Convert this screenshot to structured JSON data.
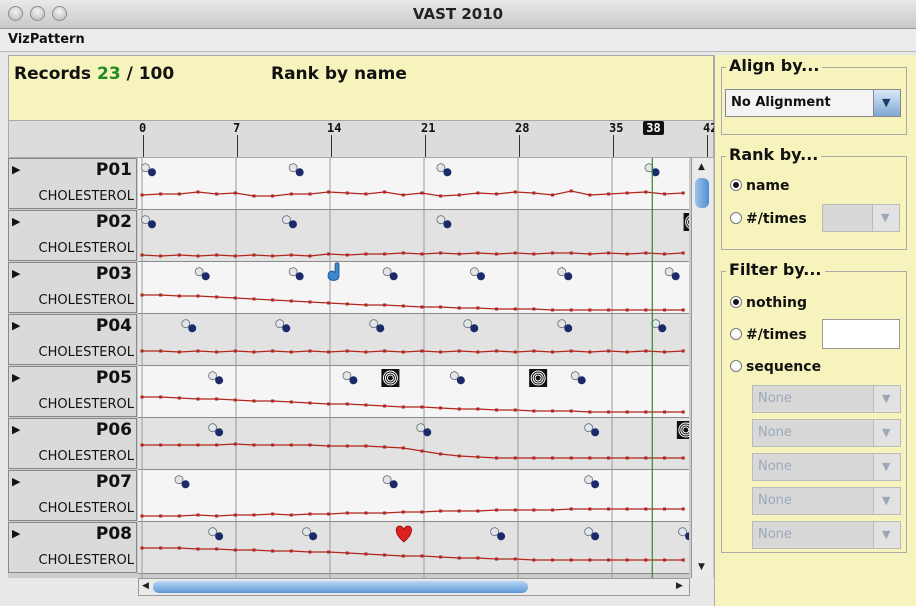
{
  "window": {
    "title": "VAST 2010"
  },
  "menu": {
    "item": "VizPattern"
  },
  "header": {
    "records_label": "Records",
    "records_count": "23",
    "records_sep": "/",
    "records_total": "100",
    "rank_label": "Rank by name"
  },
  "timeline": {
    "ticks": [
      "0",
      "7",
      "14",
      "21",
      "28",
      "35",
      "42"
    ],
    "cursor_value": "38",
    "max_day": 42
  },
  "records": [
    {
      "id": "P01",
      "variable": "CHOLESTEROL",
      "events": [
        {
          "type": "pill",
          "day": 0.5
        },
        {
          "type": "pill",
          "day": 11.5
        },
        {
          "type": "pill",
          "day": 22.5
        },
        {
          "type": "pill",
          "day": 38
        }
      ],
      "series": [
        37,
        36,
        36,
        34,
        36,
        35,
        38,
        38,
        36,
        36,
        34,
        35,
        36,
        34,
        37,
        35,
        38,
        37,
        35,
        36,
        34,
        35,
        37,
        33,
        37,
        36,
        35,
        34,
        36,
        35
      ]
    },
    {
      "id": "P02",
      "variable": "CHOLESTEROL",
      "events": [
        {
          "type": "pill",
          "day": 0.5
        },
        {
          "type": "pill",
          "day": 11
        },
        {
          "type": "pill",
          "day": 22.5
        },
        {
          "type": "spiral",
          "day": 41
        }
      ],
      "series": [
        45,
        46,
        45,
        46,
        45,
        46,
        45,
        46,
        45,
        46,
        44,
        45,
        44,
        44,
        43,
        44,
        43,
        44,
        43,
        44,
        43,
        44,
        43,
        43,
        44,
        43,
        44,
        43,
        44,
        43
      ]
    },
    {
      "id": "P03",
      "variable": "CHOLESTEROL",
      "events": [
        {
          "type": "pill",
          "day": 4.5
        },
        {
          "type": "pill",
          "day": 11.5
        },
        {
          "type": "hand",
          "day": 14.3
        },
        {
          "type": "pill",
          "day": 18.5
        },
        {
          "type": "pill",
          "day": 25
        },
        {
          "type": "pill",
          "day": 31.5
        },
        {
          "type": "pill",
          "day": 39.5
        }
      ],
      "series": [
        33,
        33,
        34,
        34,
        35,
        36,
        37,
        38,
        39,
        40,
        41,
        42,
        43,
        43,
        44,
        45,
        45,
        46,
        46,
        47,
        47,
        47,
        48,
        48,
        48,
        48,
        48,
        48,
        48,
        48
      ]
    },
    {
      "id": "P04",
      "variable": "CHOLESTEROL",
      "events": [
        {
          "type": "pill",
          "day": 3.5
        },
        {
          "type": "pill",
          "day": 10.5
        },
        {
          "type": "pill",
          "day": 17.5
        },
        {
          "type": "pill",
          "day": 24.5
        },
        {
          "type": "pill",
          "day": 31.5
        },
        {
          "type": "pill",
          "day": 38.5
        }
      ],
      "series": [
        37,
        37,
        38,
        37,
        38,
        37,
        38,
        37,
        38,
        37,
        38,
        37,
        38,
        37,
        38,
        37,
        38,
        37,
        38,
        37,
        38,
        37,
        38,
        37,
        38,
        37,
        38,
        37,
        38,
        37
      ]
    },
    {
      "id": "P05",
      "variable": "CHOLESTEROL",
      "events": [
        {
          "type": "pill",
          "day": 5.5
        },
        {
          "type": "pill",
          "day": 15.5
        },
        {
          "type": "spiral",
          "day": 18.5
        },
        {
          "type": "pill",
          "day": 23.5
        },
        {
          "type": "spiral",
          "day": 29.5
        },
        {
          "type": "pill",
          "day": 32.5
        }
      ],
      "series": [
        31,
        31,
        32,
        33,
        33,
        34,
        35,
        35,
        36,
        37,
        38,
        38,
        39,
        40,
        41,
        41,
        42,
        43,
        43,
        44,
        44,
        45,
        45,
        45,
        46,
        46,
        46,
        46,
        46,
        46
      ]
    },
    {
      "id": "P06",
      "variable": "CHOLESTEROL",
      "events": [
        {
          "type": "pill",
          "day": 5.5
        },
        {
          "type": "pill",
          "day": 21
        },
        {
          "type": "pill",
          "day": 33.5
        },
        {
          "type": "spiral",
          "day": 40.5
        }
      ],
      "series": [
        27,
        27,
        27,
        27,
        27,
        26,
        27,
        27,
        27,
        27,
        28,
        28,
        28,
        29,
        30,
        33,
        36,
        38,
        39,
        40,
        40,
        40,
        40,
        40,
        40,
        40,
        40,
        40,
        40,
        40
      ]
    },
    {
      "id": "P07",
      "variable": "CHOLESTEROL",
      "events": [
        {
          "type": "pill",
          "day": 3
        },
        {
          "type": "pill",
          "day": 18.5
        },
        {
          "type": "pill",
          "day": 33.5
        }
      ],
      "series": [
        46,
        46,
        46,
        45,
        46,
        45,
        45,
        44,
        45,
        44,
        44,
        43,
        43,
        43,
        42,
        42,
        41,
        41,
        41,
        40,
        40,
        40,
        40,
        39,
        39,
        39,
        39,
        39,
        39,
        39
      ]
    },
    {
      "id": "P08",
      "variable": "CHOLESTEROL",
      "events": [
        {
          "type": "pill",
          "day": 5.5
        },
        {
          "type": "pill",
          "day": 12.5
        },
        {
          "type": "heart",
          "day": 19.5
        },
        {
          "type": "pill",
          "day": 26.5
        },
        {
          "type": "pill",
          "day": 33.5
        },
        {
          "type": "pill",
          "day": 40.5
        }
      ],
      "series": [
        26,
        26,
        26,
        27,
        27,
        28,
        28,
        29,
        29,
        30,
        30,
        31,
        32,
        33,
        34,
        34,
        35,
        36,
        36,
        37,
        37,
        38,
        38,
        38,
        38,
        38,
        38,
        38,
        38,
        38
      ]
    }
  ],
  "panel": {
    "align": {
      "title": "Align by...",
      "value": "No Alignment"
    },
    "rank": {
      "title": "Rank by...",
      "options": [
        {
          "label": "name",
          "checked": true
        },
        {
          "label": "#/times",
          "checked": false
        }
      ]
    },
    "filter": {
      "title": "Filter by...",
      "options": [
        {
          "label": "nothing",
          "checked": true
        },
        {
          "label": "#/times",
          "checked": false
        },
        {
          "label": "sequence",
          "checked": false
        }
      ],
      "sequence_values": [
        "None",
        "None",
        "None",
        "None",
        "None"
      ]
    }
  },
  "colors": {
    "line": "#b0261d",
    "cursor": "#2e8b2e",
    "highlight": "#f7f3bc",
    "count": "#1f8c1f"
  },
  "icons": {
    "expand": "triangle-right-icon",
    "pill": "pill-icon",
    "hand": "hand-icon",
    "spiral": "spiral-icon",
    "heart": "heart-icon"
  }
}
